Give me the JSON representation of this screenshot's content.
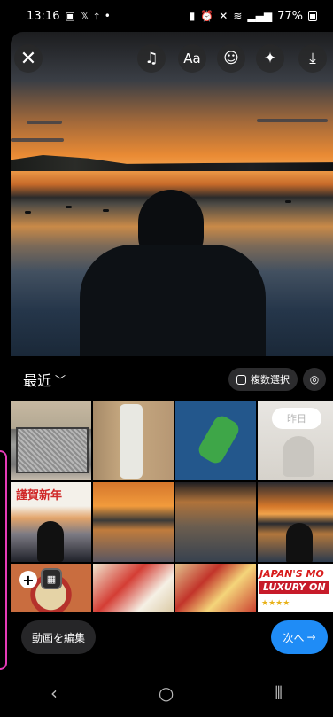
{
  "status_bar": {
    "time": "13:16",
    "left_icons": [
      "image-icon",
      "x-logo-icon",
      "upload-icon",
      "dot-icon"
    ],
    "battery": "77%"
  },
  "preview": {
    "buttons": [
      "close-icon",
      "music-icon",
      "text-icon",
      "sticker-icon",
      "effects-icon",
      "download-icon"
    ],
    "text_button_label": "Aa"
  },
  "gallery": {
    "recents_label": "最近",
    "multi_select_label": "複数選択",
    "thumbnails": [
      {
        "name": "thumb-tv"
      },
      {
        "name": "thumb-remote"
      },
      {
        "name": "thumb-map"
      },
      {
        "name": "thumb-yesterday",
        "label": "昨日"
      },
      {
        "name": "thumb-new-year",
        "label": "謹賀新年"
      },
      {
        "name": "thumb-sunset"
      },
      {
        "name": "thumb-geese"
      },
      {
        "name": "thumb-sunset-person"
      },
      {
        "name": "thumb-noodle"
      },
      {
        "name": "thumb-noodle-package"
      },
      {
        "name": "thumb-noodle-package-2"
      },
      {
        "name": "thumb-japan",
        "label_line1": "JAPAN'S MO",
        "label_line2": "LUXURY ON",
        "stars": "★★★★"
      }
    ]
  },
  "bottom": {
    "edit_video_label": "動画を編集",
    "next_label": "次へ",
    "next_arrow": "→"
  },
  "nav": {
    "back": "‹",
    "home": "○",
    "recents": "⦀"
  }
}
